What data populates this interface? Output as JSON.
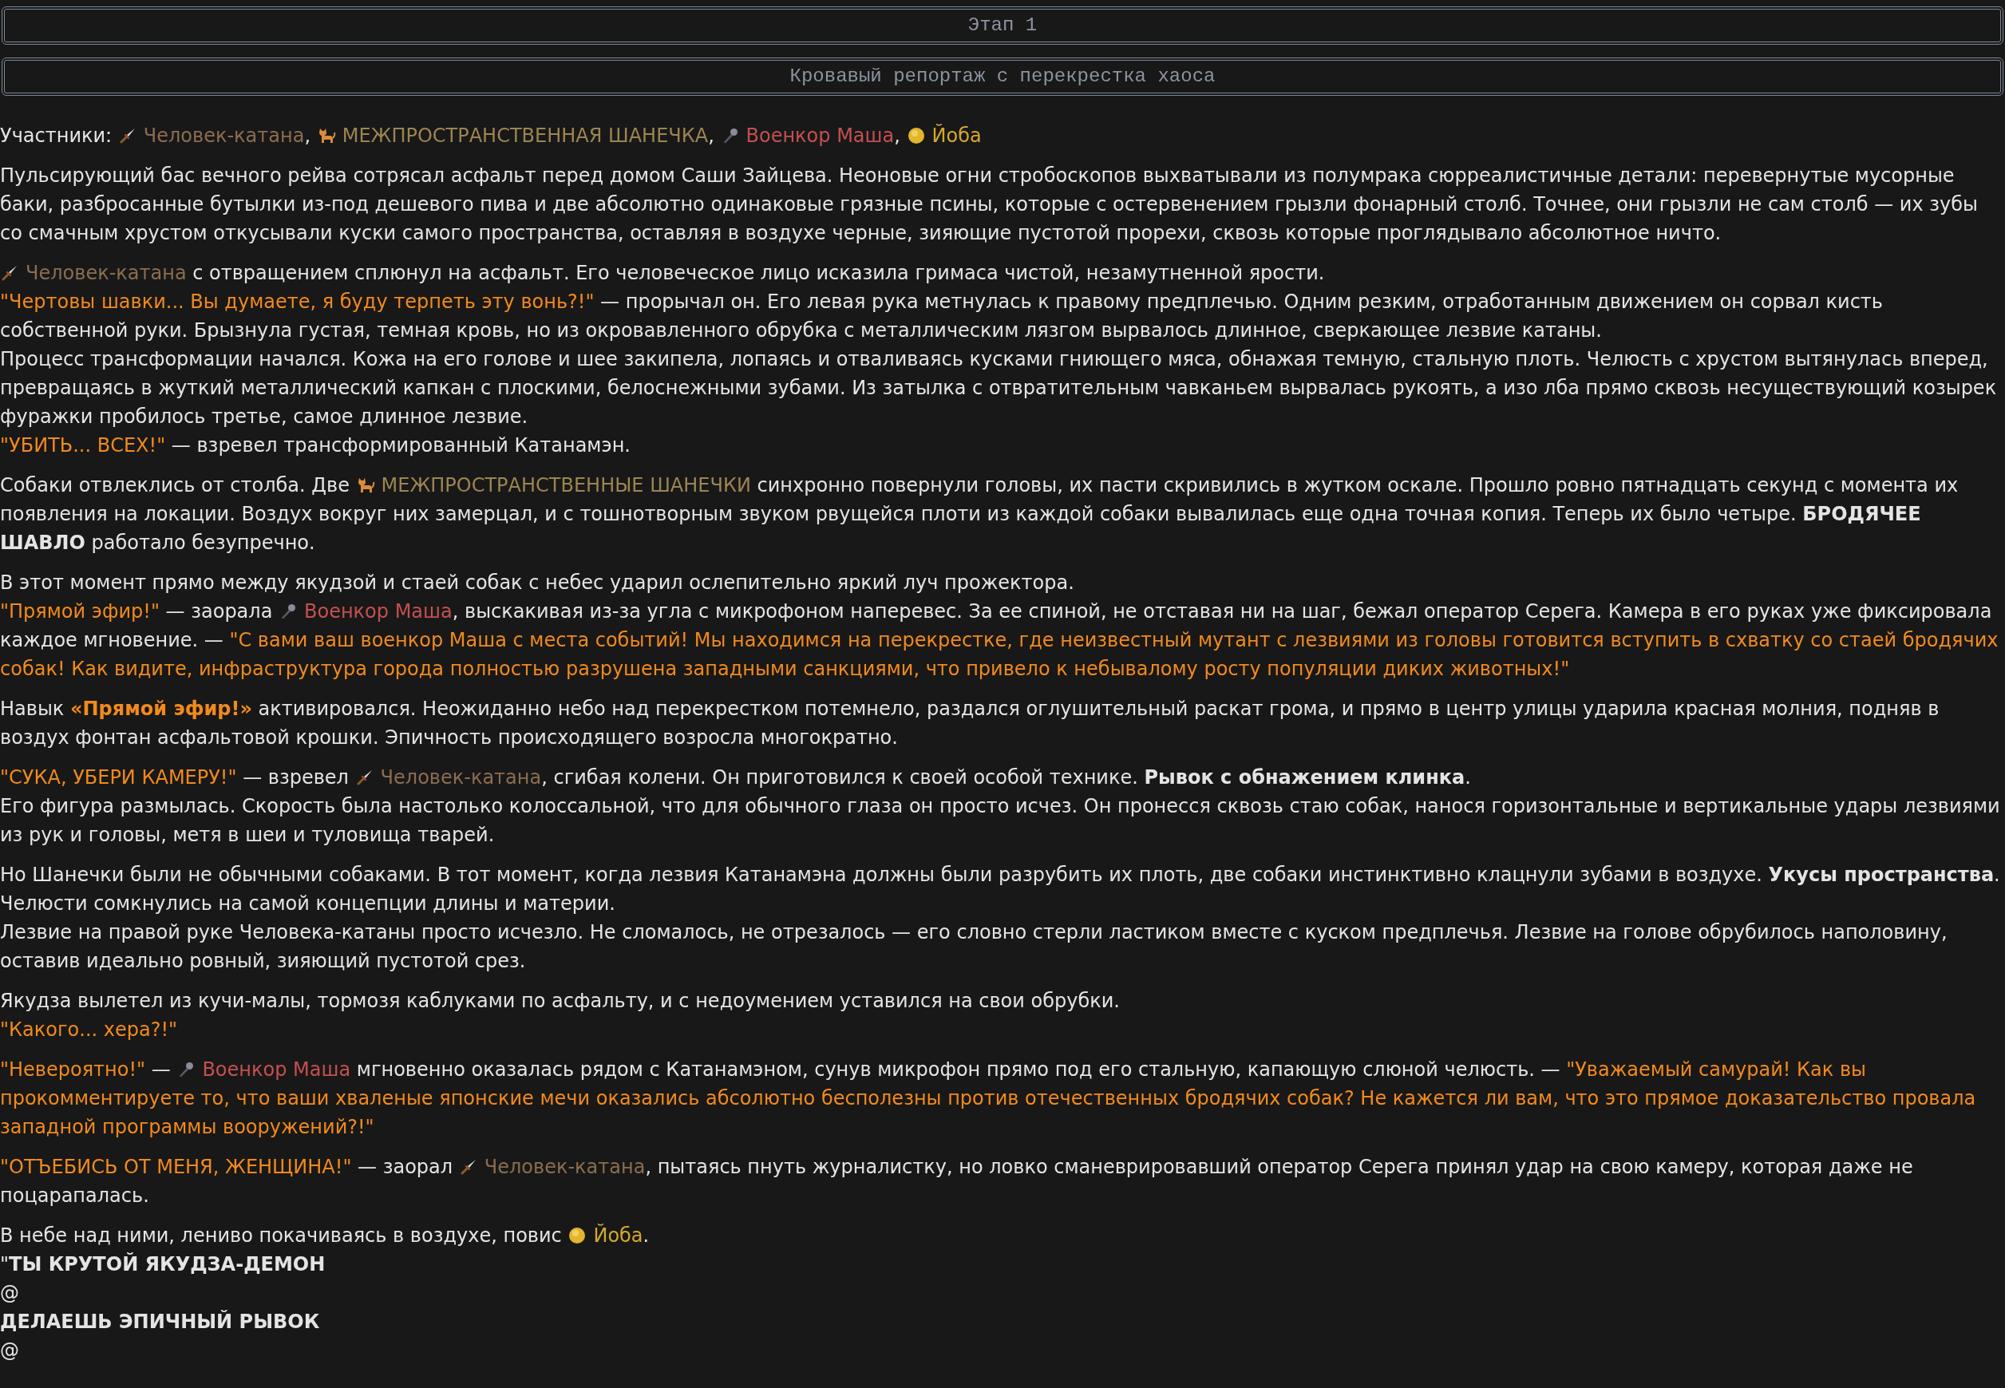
{
  "headers": [
    "Этап 1",
    "Кровавый репортаж с перекрестка хаоса"
  ],
  "participants": [
    {
      "kind": "text",
      "text": "Участники: "
    },
    {
      "kind": "swordsman",
      "text": "Человек-катана",
      "color": "#8c6d50"
    },
    {
      "kind": "text",
      "text": ", "
    },
    {
      "kind": "dog",
      "text": "МЕЖПРОСТРАНСТВЕННАЯ ШАНЕЧКА",
      "color": "#9c8552"
    },
    {
      "kind": "text",
      "text": ", "
    },
    {
      "kind": "reporter",
      "text": "Военкор Маша",
      "color": "#c4504f"
    },
    {
      "kind": "text",
      "text": ", "
    },
    {
      "kind": "orb",
      "text": "Йоба",
      "color": "#d4a82e"
    }
  ],
  "story": [
    {
      "lines": [
        [
          {
            "kind": "text",
            "text": "Пульсирующий бас вечного рейва сотрясал асфальт перед домом Саши Зайцева. Неоновые огни стробоскопов выхватывали из полумрака сюрреалистичные детали: перевернутые мусорные баки, разбросанные бутылки из-под дешевого пива и две абсолютно одинаковые грязные псины, которые с остервенением грызли фонарный столб. Точнее, они грызли не сам столб — их зубы со смачным хрустом откусывали куски самого пространства, оставляя в воздухе черные, зияющие пустотой прорехи, сквозь которые проглядывало абсолютное ничто."
          }
        ]
      ]
    },
    {
      "lines": [
        [
          {
            "kind": "swordsman",
            "text": "Человек-катана",
            "color": "#8c6d50"
          },
          {
            "kind": "text",
            "text": " с отвращением сплюнул на асфальт. Его человеческое лицо исказила гримаса чистой, незамутненной ярости."
          }
        ],
        [
          {
            "kind": "quote",
            "text": "\"Чертовы шавки... Вы думаете, я буду терпеть эту вонь?!\""
          },
          {
            "kind": "text",
            "text": " — прорычал он. Его левая рука метнулась к правому предплечью. Одним резким, отработанным движением он сорвал кисть собственной руки. Брызнула густая, темная кровь, но из окровавленного обрубка с металлическим лязгом вырвалось длинное, сверкающее лезвие катаны."
          }
        ],
        [
          {
            "kind": "text",
            "text": "Процесс трансформации начался. Кожа на его голове и шее закипела, лопаясь и отваливаясь кусками гниющего мяса, обнажая темную, стальную плоть. Челюсть с хрустом вытянулась вперед, превращаясь в жуткий металлический капкан с плоскими, белоснежными зубами. Из затылка с отвратительным чавканьем вырвалась рукоять, а изо лба прямо сквозь несуществующий козырек фуражки пробилось третье, самое длинное лезвие."
          }
        ],
        [
          {
            "kind": "quote",
            "text": "\"УБИТЬ... ВСЕХ!\""
          },
          {
            "kind": "text",
            "text": " — взревел трансформированный Катанамэн."
          }
        ]
      ]
    },
    {
      "lines": [
        [
          {
            "kind": "text",
            "text": "Собаки отвлеклись от столба. Две "
          },
          {
            "kind": "dog",
            "text": "МЕЖПРОСТРАНСТВЕННЫЕ ШАНЕЧКИ",
            "color": "#9c8552"
          },
          {
            "kind": "text",
            "text": " синхронно повернули головы, их пасти скривились в жутком оскале. Прошло ровно пятнадцать секунд с момента их появления на локации. Воздух вокруг них замерцал, и с тошнотворным звуком рвущейся плоти из каждой собаки вывалилась еще одна точная копия. Теперь их было четыре. **БРОДЯЧЕЕ ШАВЛО** работало безупречно."
          }
        ]
      ]
    },
    {
      "lines": [
        [
          {
            "kind": "text",
            "text": "В этот момент прямо между якудзой и стаей собак с небес ударил ослепительно яркий луч прожектора."
          }
        ],
        [
          {
            "kind": "quote",
            "text": "\"Прямой эфир!\""
          },
          {
            "kind": "text",
            "text": " — заорала "
          },
          {
            "kind": "reporter",
            "text": "Военкор Маша",
            "color": "#c4504f"
          },
          {
            "kind": "text",
            "text": ", выскакивая из-за угла с микрофоном наперевес. За ее спиной, не отставая ни на шаг, бежал оператор Серега. Камера в его руках уже фиксировала каждое мгновение. — "
          },
          {
            "kind": "quote",
            "text": "\"С вами ваш военкор Маша с места событий! Мы находимся на перекрестке, где неизвестный мутант с лезвиями из головы готовится вступить в схватку со стаей бродячих собак! Как видите, инфраструктура города полностью разрушена западными санкциями, что привело к небывалому росту популяции диких животных!\""
          }
        ]
      ]
    },
    {
      "lines": [
        [
          {
            "kind": "text",
            "text": "Навык "
          },
          {
            "kind": "quote",
            "text": "**«Прямой эфир!»**"
          },
          {
            "kind": "text",
            "text": " активировался. Неожиданно небо над перекрестком потемнело, раздался оглушительный раскат грома, и прямо в центр улицы ударила красная молния, подняв в воздух фонтан асфальтовой крошки. Эпичность происходящего возросла многократно."
          }
        ]
      ]
    },
    {
      "lines": [
        [
          {
            "kind": "quote",
            "text": "\"СУКА, УБЕРИ КАМЕРУ!\""
          },
          {
            "kind": "text",
            "text": " — взревел "
          },
          {
            "kind": "swordsman",
            "text": "Человек-катана",
            "color": "#8c6d50"
          },
          {
            "kind": "text",
            "text": ", сгибая колени. Он приготовился к своей особой технике. **Рывок с обнажением клинка**."
          }
        ],
        [
          {
            "kind": "text",
            "text": "Его фигура размылась. Скорость была настолько колоссальной, что для обычного глаза он просто исчез. Он пронесся сквозь стаю собак, нанося горизонтальные и вертикальные удары лезвиями из рук и головы, метя в шеи и туловища тварей."
          }
        ]
      ]
    },
    {
      "lines": [
        [
          {
            "kind": "text",
            "text": "Но Шанечки были не обычными собаками. В тот момент, когда лезвия Катанамэна должны были разрубить их плоть, две собаки инстинктивно клацнули зубами в воздухе. **Укусы пространства**. Челюсти сомкнулись на самой концепции длины и материи."
          }
        ],
        [
          {
            "kind": "text",
            "text": "Лезвие на правой руке Человека-катаны просто исчезло. Не сломалось, не отрезалось — его словно стерли ластиком вместе с куском предплечья. Лезвие на голове обрубилось наполовину, оставив идеально ровный, зияющий пустотой срез."
          }
        ]
      ]
    },
    {
      "lines": [
        [
          {
            "kind": "text",
            "text": "Якудза вылетел из кучи-малы, тормозя каблуками по асфальту, и с недоумением уставился на свои обрубки."
          }
        ],
        [
          {
            "kind": "quote",
            "text": "\"Какого... хера?!\""
          }
        ]
      ]
    },
    {
      "lines": [
        [
          {
            "kind": "quote",
            "text": "\"Невероятно!\""
          },
          {
            "kind": "text",
            "text": " — "
          },
          {
            "kind": "reporter",
            "text": "Военкор Маша",
            "color": "#c4504f"
          },
          {
            "kind": "text",
            "text": " мгновенно оказалась рядом с Катанамэном, сунув микрофон прямо под его стальную, капающую слюной челюсть. — "
          },
          {
            "kind": "quote",
            "text": "\"Уважаемый самурай! Как вы прокомментируете то, что ваши хваленые японские мечи оказались абсолютно бесполезны против отечественных бродячих собак? Не кажется ли вам, что это прямое доказательство провала западной программы вооружений?!\""
          }
        ]
      ]
    },
    {
      "lines": [
        [
          {
            "kind": "quote",
            "text": "\"ОТЪЕБИСЬ ОТ МЕНЯ, ЖЕНЩИНА!\""
          },
          {
            "kind": "text",
            "text": " — заорал "
          },
          {
            "kind": "swordsman",
            "text": "Человек-катана",
            "color": "#8c6d50"
          },
          {
            "kind": "text",
            "text": ", пытаясь пнуть журналистку, но ловко сманеврировавший оператор Серега принял удар на свою камеру, которая даже не поцарапалась."
          }
        ]
      ]
    },
    {
      "lines": [
        [
          {
            "kind": "text",
            "text": "В небе над ними, лениво покачиваясь в воздухе, повис "
          },
          {
            "kind": "orb",
            "text": "Йоба",
            "color": "#d4a82e"
          },
          {
            "kind": "text",
            "text": "."
          }
        ],
        [
          {
            "kind": "text",
            "text": "\"**ТЫ КРУТОЙ ЯКУДЗА-ДЕМОН**"
          }
        ],
        [
          {
            "kind": "text",
            "text": "@"
          }
        ],
        [
          {
            "kind": "text",
            "text": "**ДЕЛАЕШЬ ЭПИЧНЫЙ РЫВОК**"
          }
        ],
        [
          {
            "kind": "text",
            "text": "@"
          }
        ]
      ]
    }
  ]
}
